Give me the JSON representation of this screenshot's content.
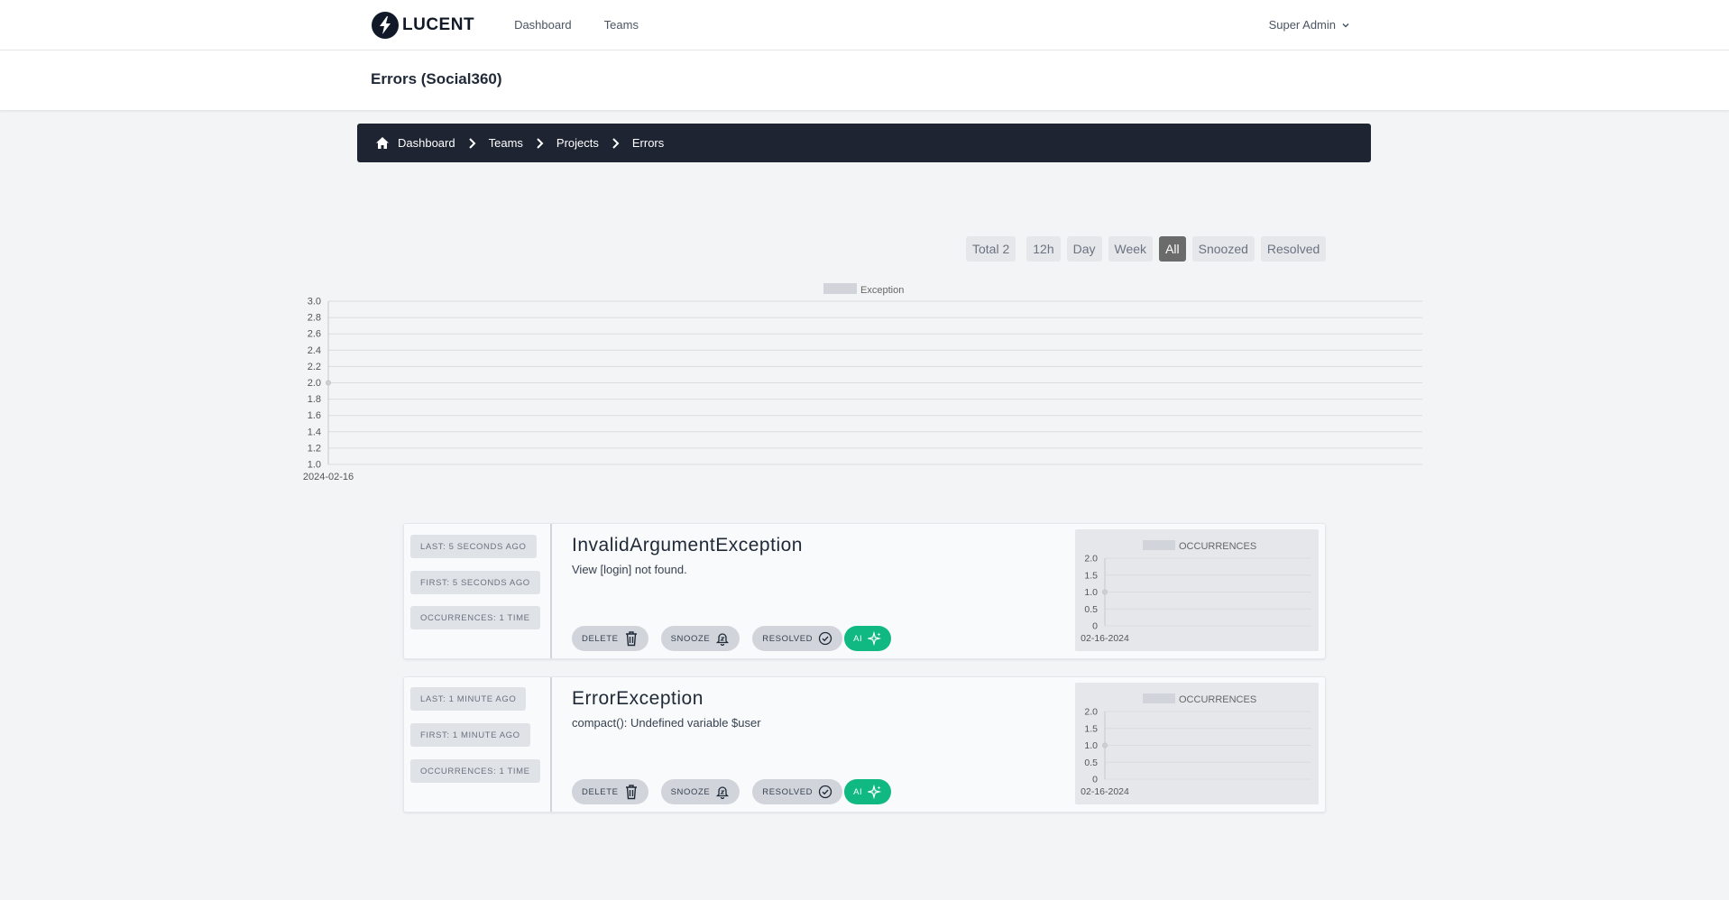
{
  "app": {
    "logo_text": "LUCENT",
    "nav": [
      "Dashboard",
      "Teams"
    ],
    "user": "Super Admin"
  },
  "page": {
    "title": "Errors (Social360)"
  },
  "breadcrumb": [
    "Dashboard",
    "Teams",
    "Projects",
    "Errors"
  ],
  "filters": {
    "total": "Total 2",
    "options": [
      "12h",
      "Day",
      "Week",
      "All",
      "Snoozed",
      "Resolved"
    ],
    "active": "All"
  },
  "chart_data": {
    "type": "line",
    "legend": [
      "Exception"
    ],
    "x": [
      "2024-02-16"
    ],
    "series": [
      {
        "name": "Exception",
        "values": [
          2.0
        ]
      }
    ],
    "ylim": [
      1.0,
      3.0
    ],
    "yticks": [
      "3.0",
      "2.8",
      "2.6",
      "2.4",
      "2.2",
      "2.0",
      "1.8",
      "1.6",
      "1.4",
      "1.2",
      "1.0"
    ],
    "grid": true,
    "legend_position": "top-center"
  },
  "errors": [
    {
      "last": "LAST: 5 SECONDS AGO",
      "first": "FIRST: 5 SECONDS AGO",
      "occurrences": "OCCURRENCES: 1 TIME",
      "title": "InvalidArgumentException",
      "message": "View [login] not found.",
      "actions": {
        "delete": "DELETE",
        "snooze": "SNOOZE",
        "resolved": "RESOLVED",
        "ai": "AI"
      },
      "chart_data": {
        "type": "line",
        "legend": [
          "OCCURRENCES"
        ],
        "x": [
          "02-16-2024"
        ],
        "series": [
          {
            "name": "OCCURRENCES",
            "values": [
              1.0
            ]
          }
        ],
        "ylim": [
          0,
          2.0
        ],
        "yticks": [
          "2.0",
          "1.5",
          "1.0",
          "0.5",
          "0"
        ]
      }
    },
    {
      "last": "LAST: 1 MINUTE AGO",
      "first": "FIRST: 1 MINUTE AGO",
      "occurrences": "OCCURRENCES: 1 TIME",
      "title": "ErrorException",
      "message": "compact(): Undefined variable $user",
      "actions": {
        "delete": "DELETE",
        "snooze": "SNOOZE",
        "resolved": "RESOLVED",
        "ai": "AI"
      },
      "chart_data": {
        "type": "line",
        "legend": [
          "OCCURRENCES"
        ],
        "x": [
          "02-16-2024"
        ],
        "series": [
          {
            "name": "OCCURRENCES",
            "values": [
              1.0
            ]
          }
        ],
        "ylim": [
          0,
          2.0
        ],
        "yticks": [
          "2.0",
          "1.5",
          "1.0",
          "0.5",
          "0"
        ]
      }
    }
  ],
  "colors": {
    "breadcrumb_bg": "#1f2433",
    "filter_active": "#6b6b6b",
    "ai_button": "#10b981",
    "legend_swatch": "#d1d5db"
  }
}
